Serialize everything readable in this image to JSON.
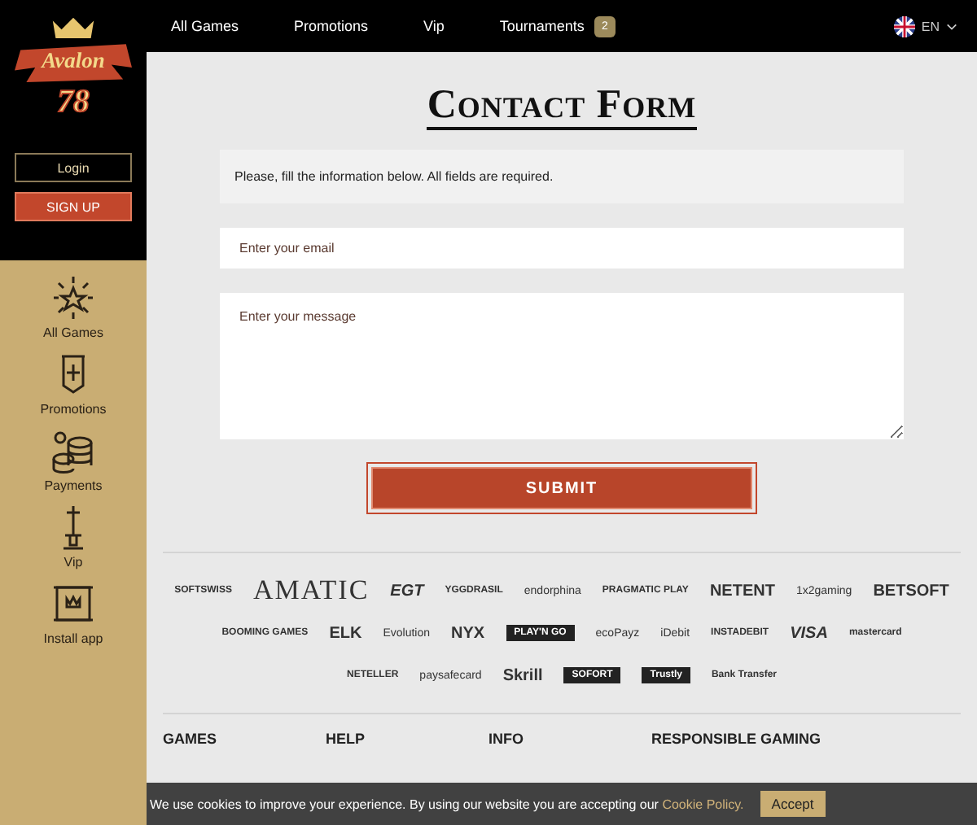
{
  "logo": {
    "name": "Avalon",
    "number": "78"
  },
  "auth": {
    "login": "Login",
    "signup": "SIGN UP"
  },
  "top_nav": [
    {
      "label": "All Games"
    },
    {
      "label": "Promotions"
    },
    {
      "label": "Vip"
    },
    {
      "label": "Tournaments",
      "badge": "2"
    }
  ],
  "language": {
    "code": "EN"
  },
  "sidebar": {
    "items": [
      {
        "label": "All Games",
        "kind": "burst"
      },
      {
        "label": "Promotions",
        "kind": "banner"
      },
      {
        "label": "Payments",
        "kind": "coins"
      },
      {
        "label": "Vip",
        "kind": "sword"
      },
      {
        "label": "Install app",
        "kind": "scroll"
      }
    ]
  },
  "form": {
    "title": "Contact Form",
    "notice": "Please, fill the information below. All fields are required.",
    "email": {
      "placeholder": "Enter your email"
    },
    "message": {
      "placeholder": "Enter your message"
    },
    "submit": "SUBMIT"
  },
  "partners": [
    [
      {
        "label": "SOFTSWISS",
        "kind": "small"
      },
      {
        "label": "AMATIC",
        "kind": "big"
      },
      {
        "label": "EGT",
        "kind": "italic"
      },
      {
        "label": "YGGDRASIL",
        "kind": "small"
      },
      {
        "label": "endorphina",
        "kind": "plain"
      },
      {
        "label": "PRAGMATIC PLAY",
        "kind": "small"
      },
      {
        "label": "NETENT",
        "kind": "bold"
      },
      {
        "label": "1x2gaming",
        "kind": "plain"
      },
      {
        "label": "BETSOFT",
        "kind": "bold"
      }
    ],
    [
      {
        "label": "BOOMING GAMES",
        "kind": "small"
      },
      {
        "label": "ELK",
        "kind": "bold"
      },
      {
        "label": "Evolution",
        "kind": "plain"
      },
      {
        "label": "NYX",
        "kind": "bold"
      },
      {
        "label": "PLAY'N GO",
        "kind": "box"
      },
      {
        "label": "ecoPayz",
        "kind": "plain"
      },
      {
        "label": "iDebit",
        "kind": "plain"
      },
      {
        "label": "INSTADEBIT",
        "kind": "small"
      },
      {
        "label": "VISA",
        "kind": "italic"
      },
      {
        "label": "mastercard",
        "kind": "small"
      }
    ],
    [
      {
        "label": "NETELLER",
        "kind": "small"
      },
      {
        "label": "paysafecard",
        "kind": "plain"
      },
      {
        "label": "Skrill",
        "kind": "bold"
      },
      {
        "label": "SOFORT",
        "kind": "box"
      },
      {
        "label": "Trustly",
        "kind": "box"
      },
      {
        "label": "Bank Transfer",
        "kind": "small"
      }
    ]
  ],
  "footer": {
    "columns": [
      "GAMES",
      "HELP",
      "INFO",
      "RESPONSIBLE GAMING"
    ]
  },
  "cookie_bar": {
    "text": "We use cookies to improve your experience. By using our website you are accepting our",
    "link": "Cookie Policy.",
    "button": "Accept"
  }
}
